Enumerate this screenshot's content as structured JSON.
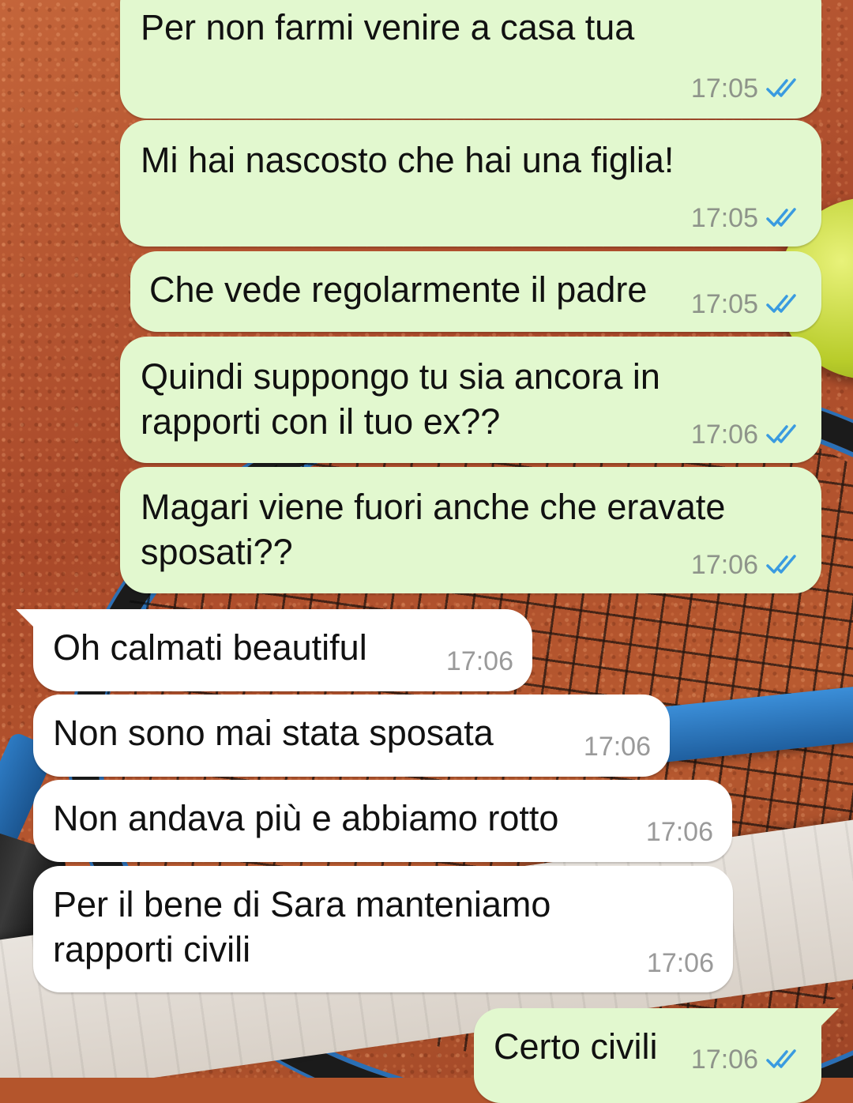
{
  "messages": [
    {
      "text": "Per non farmi venire a casa tua",
      "time": "17:05",
      "status_icon": "double-check-read-icon"
    },
    {
      "text": "Mi hai nascosto che hai una figlia!",
      "time": "17:05",
      "status_icon": "double-check-read-icon"
    },
    {
      "text": "Che vede regolarmente il padre",
      "time": "17:05",
      "status_icon": "double-check-read-icon"
    },
    {
      "text": "Quindi suppongo tu sia ancora in\nrapporti con il tuo ex??",
      "time": "17:06",
      "status_icon": "double-check-read-icon"
    },
    {
      "text": "Magari viene fuori anche che eravate\nsposati??",
      "time": "17:06",
      "status_icon": "double-check-read-icon"
    },
    {
      "text": "Oh calmati beautiful",
      "time": "17:06"
    },
    {
      "text": "Non sono mai stata sposata",
      "time": "17:06"
    },
    {
      "text": "Non andava più e abbiamo rotto",
      "time": "17:06"
    },
    {
      "text": "Per il bene di Sara manteniamo\nrapporti civili",
      "time": "17:06"
    },
    {
      "text": "Certo civili",
      "time": "17:06",
      "status_icon": "double-check-read-icon"
    }
  ],
  "colors": {
    "outgoing_bubble": "#e2f8cf",
    "incoming_bubble": "#ffffff",
    "read_ticks": "#3a9be0",
    "timestamp": "#8e948a"
  }
}
